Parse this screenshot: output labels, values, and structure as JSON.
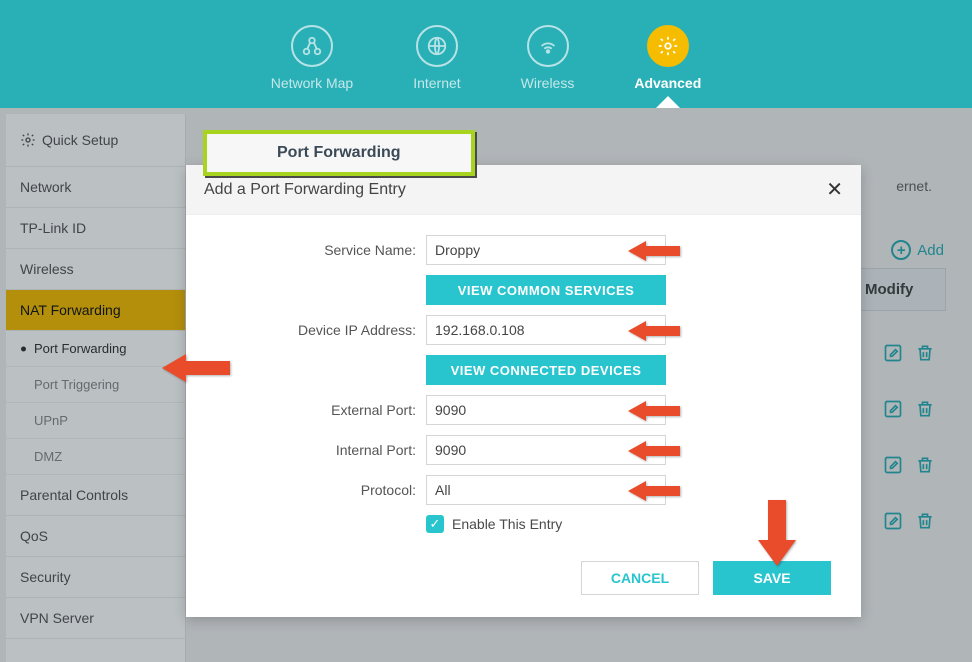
{
  "topnav": {
    "items": [
      {
        "label": "Network Map"
      },
      {
        "label": "Internet"
      },
      {
        "label": "Wireless"
      },
      {
        "label": "Advanced"
      }
    ]
  },
  "sidebar": {
    "items": [
      {
        "label": "Quick Setup"
      },
      {
        "label": "Network"
      },
      {
        "label": "TP-Link ID"
      },
      {
        "label": "Wireless"
      },
      {
        "label": "NAT Forwarding"
      },
      {
        "label": "Parental Controls"
      },
      {
        "label": "QoS"
      },
      {
        "label": "Security"
      },
      {
        "label": "VPN Server"
      }
    ],
    "subitems": [
      {
        "label": "Port Forwarding"
      },
      {
        "label": "Port Triggering"
      },
      {
        "label": "UPnP"
      },
      {
        "label": "DMZ"
      }
    ]
  },
  "page": {
    "title": "Port Forwarding",
    "hint_trailing": "ernet.",
    "add_label": "Add",
    "column_modify": "Modify"
  },
  "modal": {
    "title": "Add a Port Forwarding Entry",
    "labels": {
      "service_name": "Service Name:",
      "device_ip": "Device IP Address:",
      "external_port": "External Port:",
      "internal_port": "Internal Port:",
      "protocol": "Protocol:",
      "enable": "Enable This Entry"
    },
    "values": {
      "service_name": "Droppy",
      "device_ip": "192.168.0.108",
      "external_port": "9090",
      "internal_port": "9090",
      "protocol": "All",
      "enabled": true
    },
    "buttons": {
      "view_common_services": "VIEW COMMON SERVICES",
      "view_connected_devices": "VIEW CONNECTED DEVICES",
      "cancel": "CANCEL",
      "save": "SAVE"
    }
  }
}
